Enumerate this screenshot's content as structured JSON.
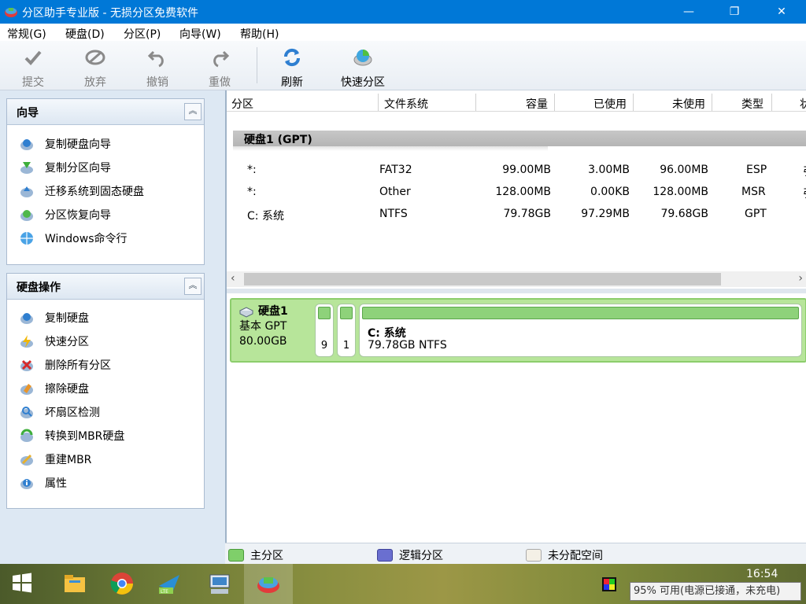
{
  "window": {
    "title": "分区助手专业版 - 无损分区免费软件",
    "controls": {
      "minimize": "—",
      "maximize": "❐",
      "close": "✕"
    }
  },
  "menu": [
    "常规(G)",
    "硬盘(D)",
    "分区(P)",
    "向导(W)",
    "帮助(H)"
  ],
  "toolbar": [
    {
      "label": "提交",
      "icon": "check-icon",
      "enabled": false
    },
    {
      "label": "放弃",
      "icon": "discard-icon",
      "enabled": false
    },
    {
      "label": "撤销",
      "icon": "undo-icon",
      "enabled": false
    },
    {
      "label": "重做",
      "icon": "redo-icon",
      "enabled": false
    },
    {
      "label": "刷新",
      "icon": "refresh-icon",
      "enabled": true
    },
    {
      "label": "快速分区",
      "icon": "quick-partition-icon",
      "enabled": true
    }
  ],
  "sidebar": {
    "wizard": {
      "title": "向导",
      "items": [
        "复制硬盘向导",
        "复制分区向导",
        "迁移系统到固态硬盘",
        "分区恢复向导",
        "Windows命令行"
      ]
    },
    "disk_ops": {
      "title": "硬盘操作",
      "items": [
        "复制硬盘",
        "快速分区",
        "删除所有分区",
        "擦除硬盘",
        "坏扇区检测",
        "转换到MBR硬盘",
        "重建MBR",
        "属性"
      ]
    }
  },
  "table": {
    "columns": [
      "分区",
      "文件系统",
      "容量",
      "已使用",
      "未使用",
      "类型",
      "状"
    ],
    "disk_label": "硬盘1 (GPT)",
    "rows": [
      {
        "partition": "*:",
        "fs": "FAT32",
        "capacity": "99.00MB",
        "used": "3.00MB",
        "free": "96.00MB",
        "type": "ESP",
        "status": "引"
      },
      {
        "partition": "*:",
        "fs": "Other",
        "capacity": "128.00MB",
        "used": "0.00KB",
        "free": "128.00MB",
        "type": "MSR",
        "status": "引"
      },
      {
        "partition": "C: 系统",
        "fs": "NTFS",
        "capacity": "79.78GB",
        "used": "97.29MB",
        "free": "79.68GB",
        "type": "GPT",
        "status": ""
      }
    ]
  },
  "diskmap": {
    "name": "硬盘1",
    "type": "基本 GPT",
    "size": "80.00GB",
    "small_partitions": [
      "9",
      "1"
    ],
    "main_partition": {
      "name": "C: 系统",
      "detail": "79.78GB NTFS"
    }
  },
  "legend": [
    "主分区",
    "逻辑分区",
    "未分配空间"
  ],
  "legend_colors": {
    "primary": "#7fcf6a",
    "logical": "#6a6fd0",
    "unallocated": "#f4f0e6"
  },
  "taskbar": {
    "clock": "16:54",
    "tooltip": "95% 可用(电源已接通，未充电)"
  }
}
